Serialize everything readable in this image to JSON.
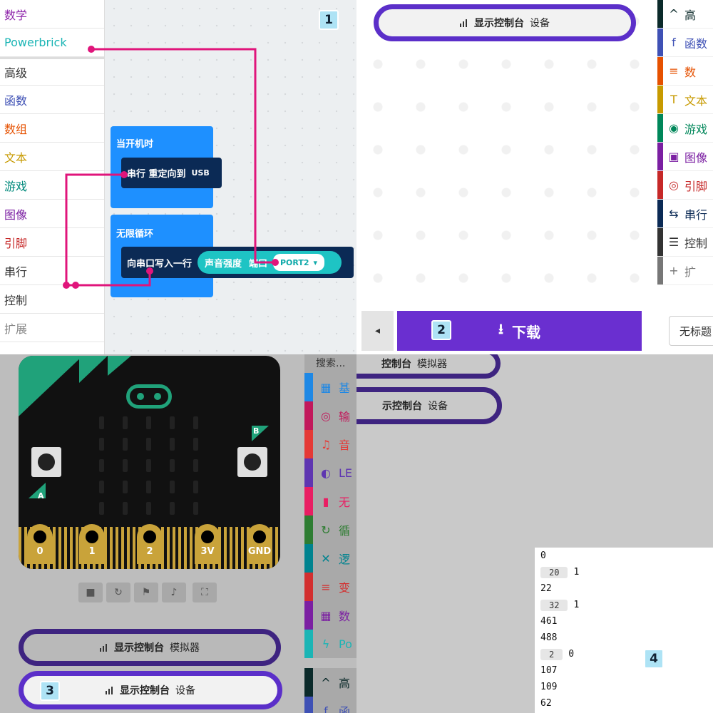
{
  "panel1": {
    "categories": [
      {
        "label": "数学",
        "color": "#8e24aa"
      },
      {
        "label": "Powerbrick",
        "color": "#1bb5b5"
      },
      {
        "label": "高级",
        "color": "#333333"
      },
      {
        "label": "函数",
        "color": "#3f51b5"
      },
      {
        "label": "数组",
        "color": "#e65100"
      },
      {
        "label": "文本",
        "color": "#c79a00"
      },
      {
        "label": "游戏",
        "color": "#00897b"
      },
      {
        "label": "图像",
        "color": "#7b1fa2"
      },
      {
        "label": "引脚",
        "color": "#c62828"
      },
      {
        "label": "串行",
        "color": "#333333"
      },
      {
        "label": "控制",
        "color": "#333333"
      },
      {
        "label": "扩展",
        "color": "#888888"
      }
    ],
    "number": "1",
    "on_start": "当开机时",
    "serial_redirect": "串行 重定向到",
    "serial_redirect_target": "USB",
    "forever": "无限循环",
    "write_line": "向串口写入一行",
    "sound_level": "声音强度",
    "port_label": "端口",
    "port_value": "PORT2"
  },
  "panel2": {
    "number": "2",
    "console_button": {
      "label": "显示控制台",
      "sub": "设备"
    },
    "download_label": "下载",
    "project_name": "无标题",
    "toolbox": [
      {
        "icon": "^",
        "label": "高",
        "color": "#0b2a2a"
      },
      {
        "icon": "f",
        "label": "函数",
        "color": "#3f51b5"
      },
      {
        "icon": "≡",
        "label": "数",
        "color": "#e65100"
      },
      {
        "icon": "T",
        "label": "文本",
        "color": "#c79a00"
      },
      {
        "icon": "◉",
        "label": "游戏",
        "color": "#00875a"
      },
      {
        "icon": "▣",
        "label": "图像",
        "color": "#7b1fa2"
      },
      {
        "icon": "◎",
        "label": "引脚",
        "color": "#c62828"
      },
      {
        "icon": "⇆",
        "label": "串行",
        "color": "#0b2a55"
      },
      {
        "icon": "☰",
        "label": "控制",
        "color": "#333333"
      },
      {
        "icon": "+",
        "label": "扩",
        "color": "#777777"
      }
    ]
  },
  "panel3": {
    "number": "3",
    "search": "搜索...",
    "buttons": {
      "a": "A",
      "b": "B"
    },
    "pins": [
      "0",
      "1",
      "2",
      "3V",
      "GND"
    ],
    "console_sim": {
      "label": "显示控制台",
      "sub": "模拟器"
    },
    "console_dev": {
      "label": "显示控制台",
      "sub": "设备"
    },
    "categories": [
      {
        "icon": "▦",
        "label": "基",
        "color": "#1e88e5"
      },
      {
        "icon": "◎",
        "label": "输",
        "color": "#c2185b"
      },
      {
        "icon": "♫",
        "label": "音",
        "color": "#e53935"
      },
      {
        "icon": "◐",
        "label": "LE",
        "color": "#5e35b1"
      },
      {
        "icon": "▮",
        "label": "无",
        "color": "#e91e63"
      },
      {
        "icon": "↻",
        "label": "循",
        "color": "#2e7d32"
      },
      {
        "icon": "✕",
        "label": "逻",
        "color": "#00838f"
      },
      {
        "icon": "≡",
        "label": "变",
        "color": "#d32f2f"
      },
      {
        "icon": "▦",
        "label": "数",
        "color": "#7b1fa2"
      },
      {
        "icon": "ϟ",
        "label": "Po",
        "color": "#1bb5b5"
      },
      {
        "icon": "^",
        "label": "高",
        "color": "#0b2a2a"
      },
      {
        "icon": "f",
        "label": "函",
        "color": "#3f51b5"
      }
    ]
  },
  "panel4": {
    "number": "4",
    "console_sim": {
      "label": "控制台",
      "sub": "模拟器"
    },
    "console_dev": {
      "label": "示控制台",
      "sub": "设备"
    },
    "log": [
      {
        "value": "0"
      },
      {
        "tag": "20",
        "value": "1"
      },
      {
        "value": "22"
      },
      {
        "tag": "32",
        "value": "1"
      },
      {
        "value": "461"
      },
      {
        "value": "488"
      },
      {
        "tag": "2",
        "value": "0"
      },
      {
        "value": "107"
      },
      {
        "value": "109"
      },
      {
        "value": "62"
      }
    ]
  }
}
